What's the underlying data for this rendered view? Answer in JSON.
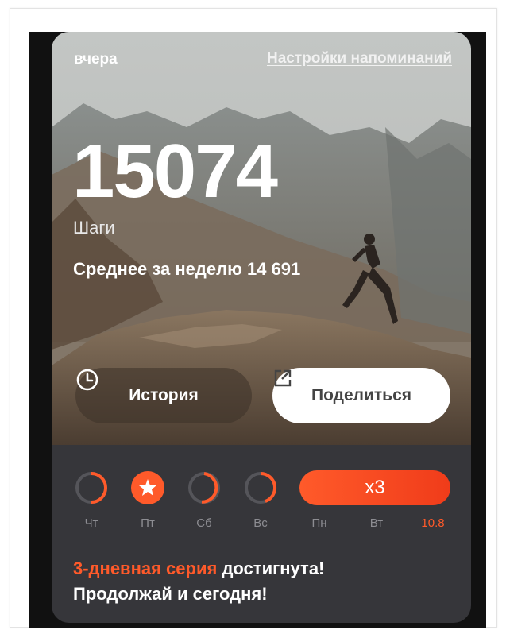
{
  "header": {
    "period": "вчера",
    "reminder_link": "Настройки напоминаний"
  },
  "stats": {
    "steps": "15074",
    "steps_label": "Шаги",
    "weekly_average": "Среднее за неделю 14 691"
  },
  "actions": {
    "history_label": "История",
    "share_label": "Поделиться"
  },
  "streak": {
    "multiplier": "x3",
    "days": [
      {
        "label": "Чт",
        "progress": 0.5
      },
      {
        "label": "Пт",
        "progress": 1.0,
        "star": true
      },
      {
        "label": "Сб",
        "progress": 0.55
      },
      {
        "label": "Вс",
        "progress": 0.45
      },
      {
        "label": "Пн"
      },
      {
        "label": "Вт"
      },
      {
        "label": "10.8",
        "today": true
      }
    ]
  },
  "message": {
    "highlight": "3-дневная серия",
    "rest_line1": " достигнута!",
    "line2": "Продолжай и сегодня!"
  },
  "colors": {
    "accent": "#ff5a2a",
    "card_bg": "#36363a"
  }
}
